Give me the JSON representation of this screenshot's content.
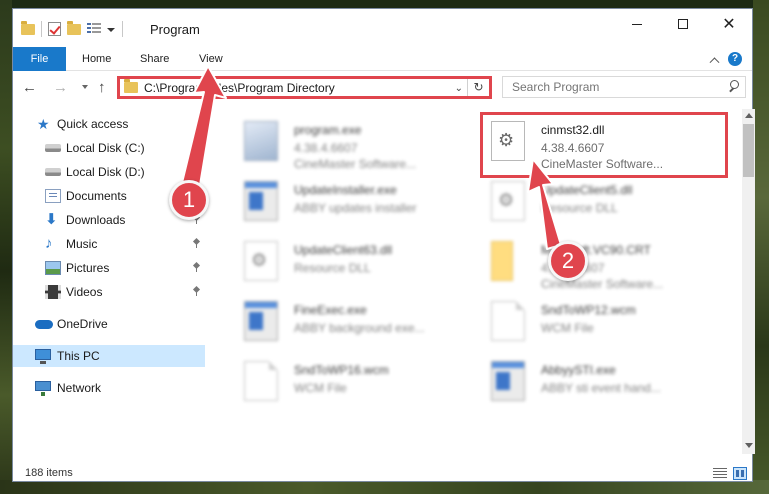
{
  "window": {
    "title": "Program"
  },
  "ribbon": {
    "tabs": [
      "File",
      "Home",
      "Share",
      "View"
    ],
    "help_label": "?"
  },
  "nav": {
    "back": "←",
    "forward": "→",
    "up": "↑",
    "address": "C:\\Program Files\\Program Directory",
    "search_placeholder": "Search Program"
  },
  "sidebar": {
    "items": [
      {
        "label": "Quick access",
        "icon": "star-icon"
      },
      {
        "label": "Local Disk (C:)",
        "icon": "disk-icon"
      },
      {
        "label": "Local Disk (D:)",
        "icon": "disk-icon"
      },
      {
        "label": "Documents",
        "icon": "documents-icon"
      },
      {
        "label": "Downloads",
        "icon": "downloads-icon"
      },
      {
        "label": "Music",
        "icon": "music-icon"
      },
      {
        "label": "Pictures",
        "icon": "pictures-icon"
      },
      {
        "label": "Videos",
        "icon": "videos-icon"
      },
      {
        "label": "OneDrive",
        "icon": "onedrive-icon"
      },
      {
        "label": "This PC",
        "icon": "pc-icon",
        "selected": true
      },
      {
        "label": "Network",
        "icon": "network-icon"
      }
    ]
  },
  "files": [
    {
      "name": "program.exe",
      "line2": "4.38.4.6607",
      "line3": "CineMaster Software...",
      "icon": "program-icon"
    },
    {
      "name": "cinmst32.dll",
      "line2": "4.38.4.6607",
      "line3": "CineMaster Software...",
      "icon": "dll-icon"
    },
    {
      "name": "UpdateInstaller.exe",
      "line2": "ABBY updates installer",
      "line3": "",
      "icon": "exe-icon"
    },
    {
      "name": "UpdateClient5.dll",
      "line2": "Resource DLL",
      "line3": "",
      "icon": "dll-icon"
    },
    {
      "name": "UpdateClient63.dll",
      "line2": "Resource DLL",
      "line3": "",
      "icon": "dll-icon"
    },
    {
      "name": "Microsoft.VC90.CRT",
      "line2": "4.38.4.6607",
      "line3": "CineMaster Software...",
      "icon": "folder-icon"
    },
    {
      "name": "FineExec.exe",
      "line2": "ABBY background exe...",
      "line3": "",
      "icon": "exe-icon"
    },
    {
      "name": "SndToWP12.wcm",
      "line2": "WCM File",
      "line3": "",
      "icon": "document-icon"
    },
    {
      "name": "SndToWP16.wcm",
      "line2": "WCM File",
      "line3": "",
      "icon": "document-icon"
    },
    {
      "name": "AbbyySTI.exe",
      "line2": "ABBY sti event hand...",
      "line3": "",
      "icon": "exe-icon"
    }
  ],
  "markers": {
    "one": "1",
    "two": "2"
  },
  "status": {
    "count": "188 items"
  },
  "colors": {
    "accent": "#1979ca",
    "callout": "#e0454d",
    "selection": "#cce8ff"
  }
}
